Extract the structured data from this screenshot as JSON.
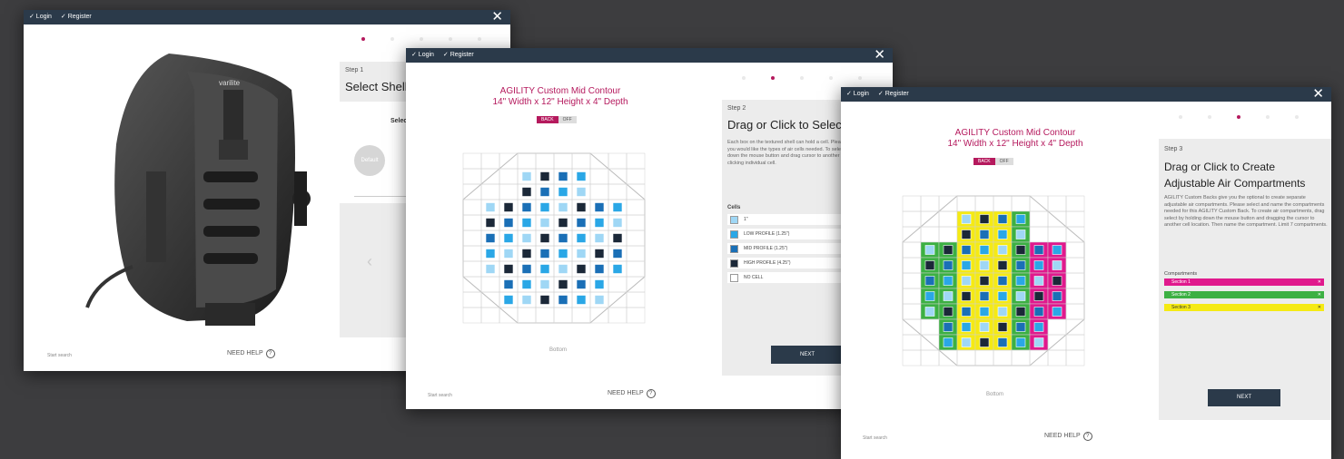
{
  "common": {
    "login": "✓ Login",
    "register": "✓ Register",
    "close": "✕",
    "need_help": "NEED HELP",
    "start_over": "Start search",
    "next": "NEXT",
    "product_title_line1": "AGILITY Custom Mid Contour",
    "product_title_line2": "14\" Width x 12\" Height x 4\" Depth",
    "toggle_on": "BACK",
    "toggle_off": "OFF",
    "bottom": "Bottom"
  },
  "win1": {
    "step": "Step 1",
    "title": "Select Shell",
    "subtitle": "Select",
    "swatch_label": "Default",
    "prev": "‹"
  },
  "win2": {
    "step": "Step 2",
    "title": "Drag or Click to Select A",
    "desc": "Each box on the textured shell can hold a cell. Please determine where you would like the types of air cells needed. To select air cells by holding down the mouse button and drag cursor to another cell location, or by clicking individual cell.",
    "cells_heading": "Cells",
    "cells": [
      {
        "label": "1\"",
        "color": "#9fd7f5"
      },
      {
        "label": "LOW PROFILE (1.25\")",
        "color": "#2aa7e6"
      },
      {
        "label": "MID PROFILE (1.25\")",
        "color": "#1a6fb6"
      },
      {
        "label": "HIGH PROFILE (4.25\")",
        "color": "#1b2838"
      },
      {
        "label": "NO CELL",
        "color": "#ffffff"
      }
    ]
  },
  "win3": {
    "step": "Step 3",
    "title_l1": "Drag or Click to Create",
    "title_l2": "Adjustable Air Compartments",
    "desc": "AGILITY Custom Backs give you the optional to create separate adjustable air compartments. Please select and name the compartments needed for this AGILITY Custom Back. To create air compartments, drag select by holding down the mouse button and dragging the cursor to another cell location. Then name the compartment. Limit 7 compartments.",
    "compartments_heading": "Compartments",
    "compartments": [
      {
        "label": "Section 1",
        "color": "#e0198d",
        "x": "✕"
      },
      {
        "label": "Section 2",
        "color": "#3cb043",
        "x": "✕"
      },
      {
        "label": "Section 3",
        "color": "#f5ea14",
        "x": "✕"
      }
    ]
  },
  "colors": {
    "dark_nav": "#2b3a4a",
    "accent": "#b5195d",
    "panel": "#ececec",
    "green": "#3cb043",
    "yellow": "#f5ea14",
    "magenta": "#e0198d"
  }
}
